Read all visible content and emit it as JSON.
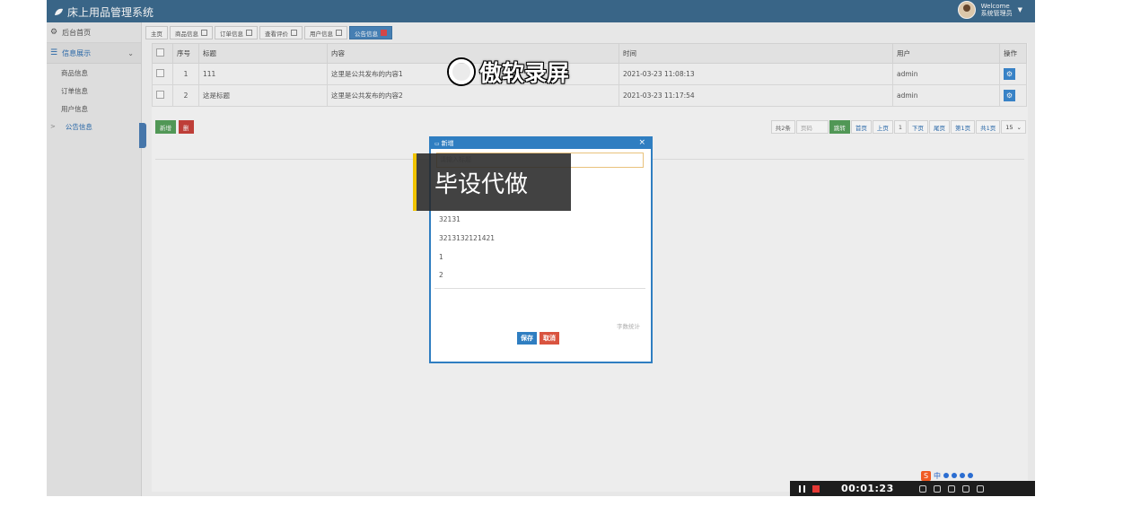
{
  "app": {
    "title": "床上用品管理系统"
  },
  "user": {
    "welcome": "Welcome",
    "role": "系统管理员"
  },
  "sidebar": {
    "home": "后台首页",
    "group": "信息展示",
    "items": [
      {
        "label": "商品信息"
      },
      {
        "label": "订单信息"
      },
      {
        "label": "用户信息"
      },
      {
        "label": "公告信息"
      }
    ]
  },
  "tabs": [
    {
      "label": "主页"
    },
    {
      "label": "商品信息"
    },
    {
      "label": "订单信息"
    },
    {
      "label": "查看评价"
    },
    {
      "label": "用户信息"
    },
    {
      "label": "公告信息"
    }
  ],
  "table": {
    "headers": [
      "序号",
      "标题",
      "内容",
      "时间",
      "用户",
      "操作"
    ],
    "rows": [
      {
        "no": "1",
        "title": "111",
        "content": "这里是公共发布的内容1",
        "time": "2021-03-23 11:08:13",
        "user": "admin"
      },
      {
        "no": "2",
        "title": "这是标题",
        "content": "这里是公共发布的内容2",
        "time": "2021-03-23 11:17:54",
        "user": "admin"
      }
    ]
  },
  "toolbar": {
    "add": "新增",
    "delete": "删"
  },
  "pager": {
    "total": "共2条",
    "page_placeholder": "页码",
    "go": "跳转",
    "first": "首页",
    "prev": "上页",
    "current": "1",
    "next": "下页",
    "last": "尾页",
    "page_of": "第1页",
    "pages_total": "共1页",
    "page_size": "15"
  },
  "dialog": {
    "title": "新增",
    "title_placeholder": "请输入标题",
    "lines": [
      "32131",
      "3213132121421",
      "1",
      "2"
    ],
    "counter": "字数统计",
    "save": "保存",
    "cancel": "取消"
  },
  "overlays": {
    "watermark": "傲软录屏",
    "banner": "毕设代做",
    "rec_time": "00:01:23",
    "ime_lang": "中"
  }
}
